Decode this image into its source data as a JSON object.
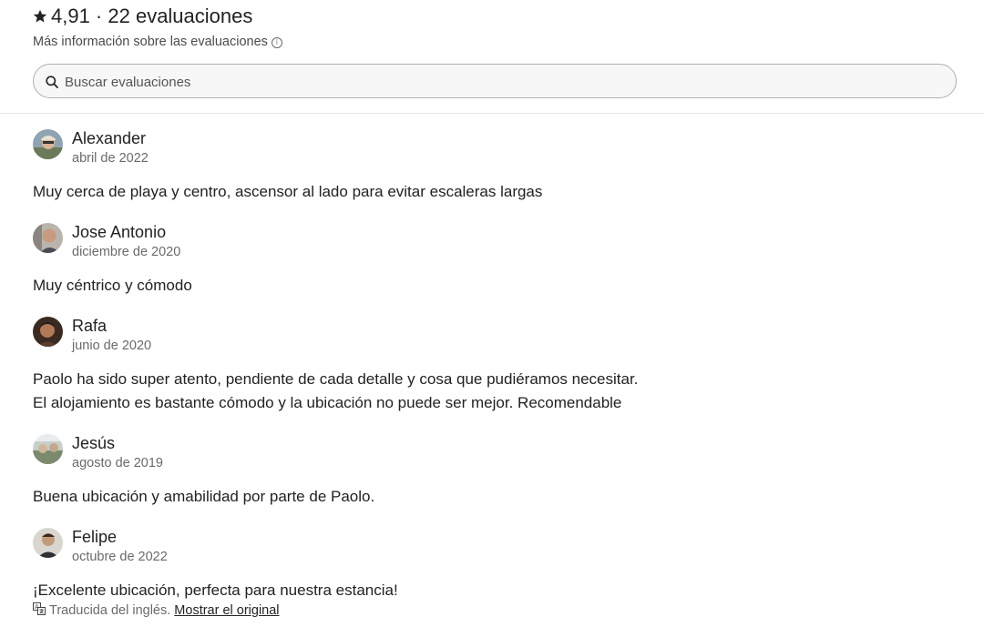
{
  "header": {
    "rating_title": "4,91 · 22 evaluaciones",
    "more_info": "Más información sobre las evaluaciones"
  },
  "search": {
    "placeholder": "Buscar evaluaciones"
  },
  "reviews": [
    {
      "name": "Alexander",
      "date": "abril de 2022",
      "text": "Muy cerca de playa y centro, ascensor al lado para evitar escaleras largas"
    },
    {
      "name": "Jose Antonio",
      "date": "diciembre de 2020",
      "text": "Muy céntrico y cómodo"
    },
    {
      "name": "Rafa",
      "date": "junio de 2020",
      "text_lines": [
        "Paolo ha sido super atento, pendiente de cada detalle y cosa que pudiéramos necesitar.",
        "El alojamiento es bastante cómodo y la ubicación no puede ser mejor. Recomendable"
      ]
    },
    {
      "name": "Jesús",
      "date": "agosto de 2019",
      "text": "Buena ubicación y amabilidad por parte de Paolo."
    },
    {
      "name": "Felipe",
      "date": "octubre de 2022",
      "text": "¡Excelente ubicación, perfecta para nuestra estancia!",
      "translation_note": "Traducida del inglés.",
      "show_original": "Mostrar el original"
    }
  ],
  "icons": {
    "rating": "star-icon",
    "info": "info-icon",
    "search": "search-icon",
    "translate": "translate-icon"
  }
}
